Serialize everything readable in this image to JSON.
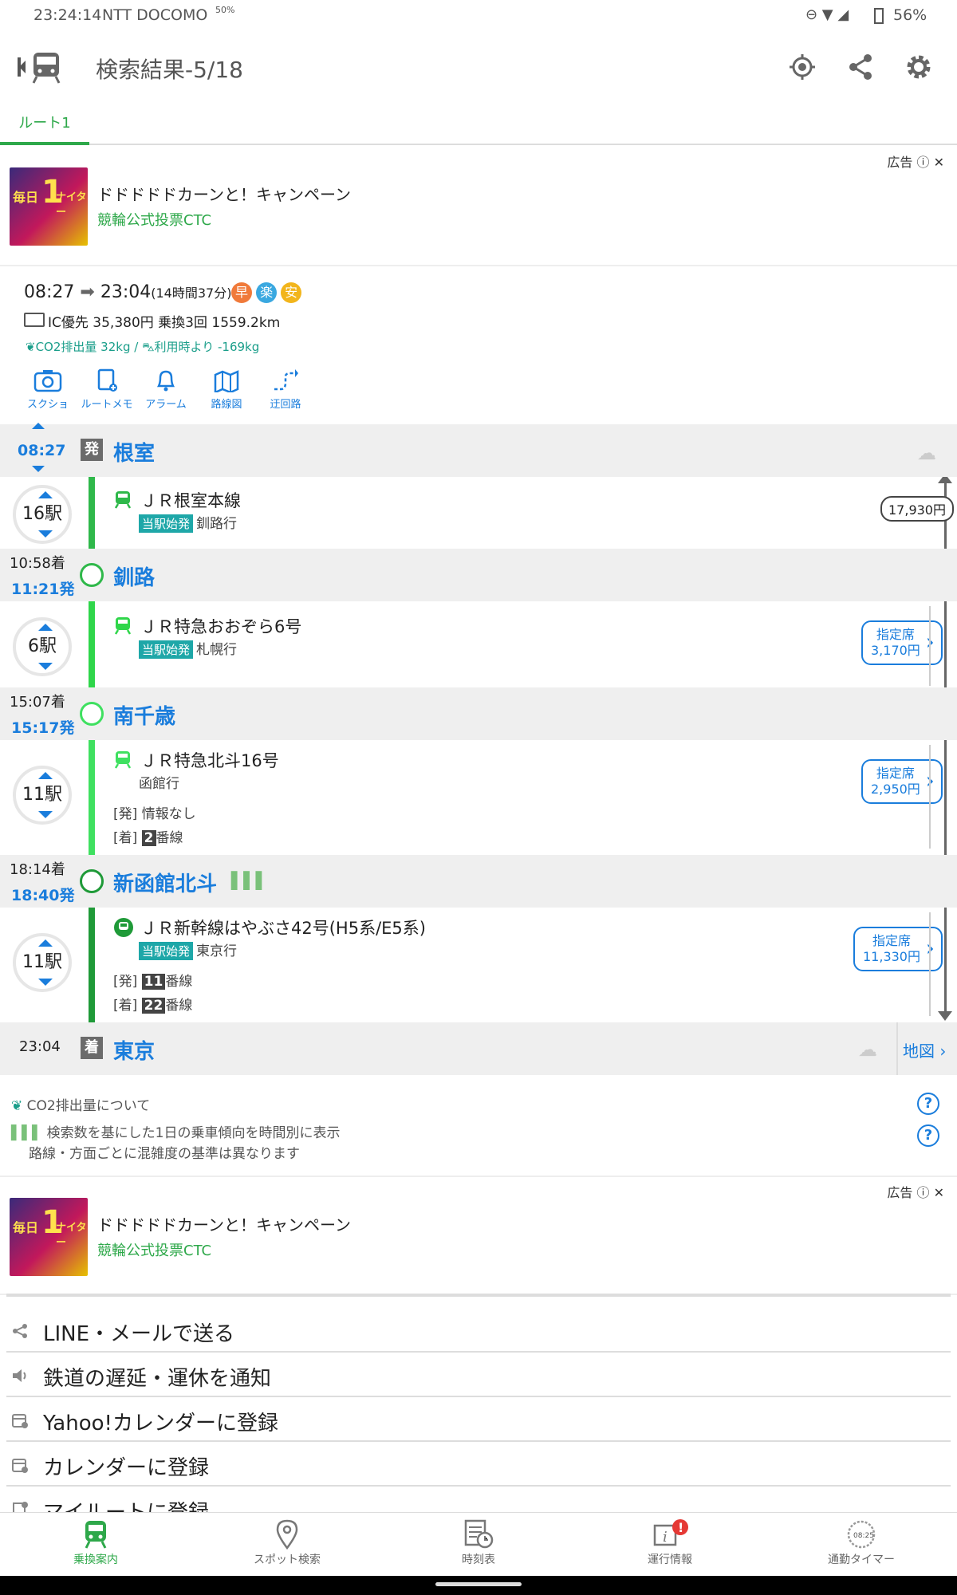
{
  "status_bar": {
    "time": "23:24:14",
    "carrier": "NTT DOCOMO",
    "data_rate": "50%",
    "battery": "56%"
  },
  "header": {
    "title": "検索結果-5/18"
  },
  "tabs": [
    {
      "label": "ルート1"
    }
  ],
  "ad": {
    "label": "広告",
    "title": "ドドドドドカーンと！キャンペーン",
    "sponsor": "競輪公式投票CTC"
  },
  "summary": {
    "depart": "08:27",
    "arrive": "23:04",
    "duration": "(14時間37分)",
    "badges": [
      "早",
      "楽",
      "安"
    ],
    "fare_line": "IC優先 35,380円 乗換3回 1559.2km",
    "co2": "CO2排出量 32kg",
    "co2_compare": "利用時より -169kg",
    "actions": [
      "スクショ",
      "ルートメモ",
      "アラーム",
      "路線図",
      "迂回路"
    ]
  },
  "route": {
    "stations": [
      {
        "name": "根室",
        "arr": "",
        "dep": "08:27",
        "badge": "発"
      },
      {
        "name": "釧路",
        "arr": "10:58着",
        "dep": "11:21発"
      },
      {
        "name": "南千歳",
        "arr": "15:07着",
        "dep": "15:17発"
      },
      {
        "name": "新函館北斗",
        "arr": "18:14着",
        "dep": "18:40発"
      },
      {
        "name": "東京",
        "arr": "23:04",
        "dep": "",
        "badge": "着"
      }
    ],
    "segments": [
      {
        "stops": "16駅",
        "line": "ＪＲ根室本線",
        "tag": "当駅始発",
        "dest": "釧路行"
      },
      {
        "stops": "6駅",
        "line": "ＪＲ特急おおぞら6号",
        "tag": "当駅始発",
        "dest": "札幌行",
        "seat": "指定席",
        "seat_fare": "3,170円"
      },
      {
        "stops": "11駅",
        "line": "ＪＲ特急北斗16号",
        "dest": "函館行",
        "dep_track_label": "[発]",
        "dep_track": "情報なし",
        "arr_track_label": "[着]",
        "arr_track_num": "2",
        "arr_track_suffix": "番線",
        "seat": "指定席",
        "seat_fare": "2,950円"
      },
      {
        "stops": "11駅",
        "line": "ＪＲ新幹線はやぶさ42号(H5系/E5系)",
        "tag": "当駅始発",
        "dest": "東京行",
        "dep_track_label": "[発]",
        "dep_track_num": "11",
        "dep_track_suffix": "番線",
        "arr_track_label": "[着]",
        "arr_track_num": "22",
        "arr_track_suffix": "番線",
        "seat": "指定席",
        "seat_fare": "11,330円"
      }
    ],
    "fare_total": "17,930円",
    "map_link": "地図"
  },
  "notes": {
    "co2_about": "CO2排出量について",
    "congestion_1": "検索数を基にした1日の乗車傾向を時間別に表示",
    "congestion_2": "路線・方面ごとに混雑度の基準は異なります"
  },
  "menu": [
    "LINE・メールで送る",
    "鉄道の遅延・運休を通知",
    "Yahoo!カレンダーに登録",
    "カレンダーに登録",
    "マイルートに登録"
  ],
  "bottom_nav": [
    {
      "label": "乗換案内"
    },
    {
      "label": "スポット検索"
    },
    {
      "label": "時刻表"
    },
    {
      "label": "運行情報"
    },
    {
      "label": "通勤タイマー",
      "clock": "08:25"
    }
  ],
  "colors": {
    "accent": "#1a7ddc",
    "green": "#2ea84a",
    "line_green": "#2fb84a"
  }
}
